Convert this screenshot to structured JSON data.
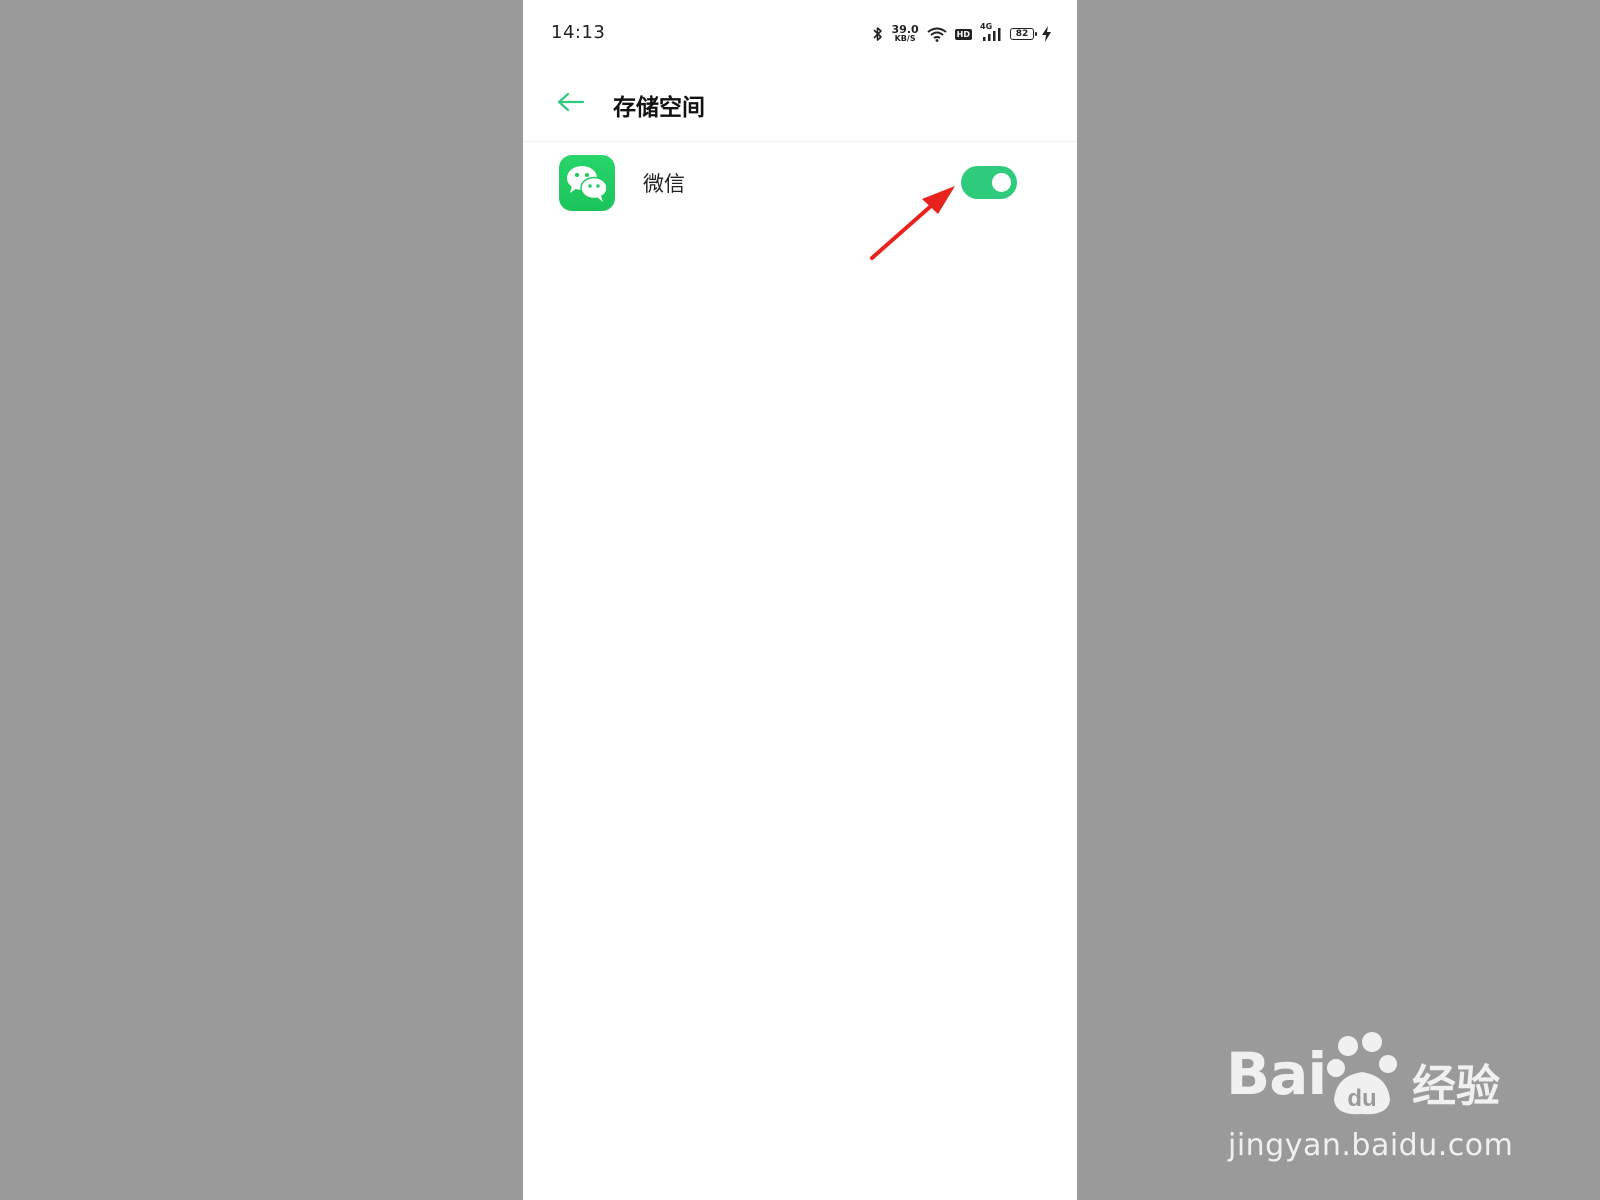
{
  "status_bar": {
    "time": "14:13",
    "net_speed_value": "39.0",
    "net_speed_unit": "KB/S",
    "hd_label": "HD",
    "network_type": "4G",
    "battery_level": "82"
  },
  "header": {
    "title": "存储空间"
  },
  "app_row": {
    "app_name": "微信",
    "toggle_on": true
  },
  "colors": {
    "accent": "#2ecb7d",
    "app_icon": "#1fc95e",
    "arrow": "#e8221c",
    "backdrop": "#9a9a9a"
  },
  "icons": [
    "back-arrow-icon",
    "bluetooth-icon",
    "wifi-icon",
    "signal-icon",
    "battery-icon",
    "charging-icon",
    "wechat-icon"
  ],
  "watermark": {
    "brand_latin": "Bai",
    "brand_du": "du",
    "brand_cn": "经验",
    "url": "jingyan.baidu.com"
  }
}
